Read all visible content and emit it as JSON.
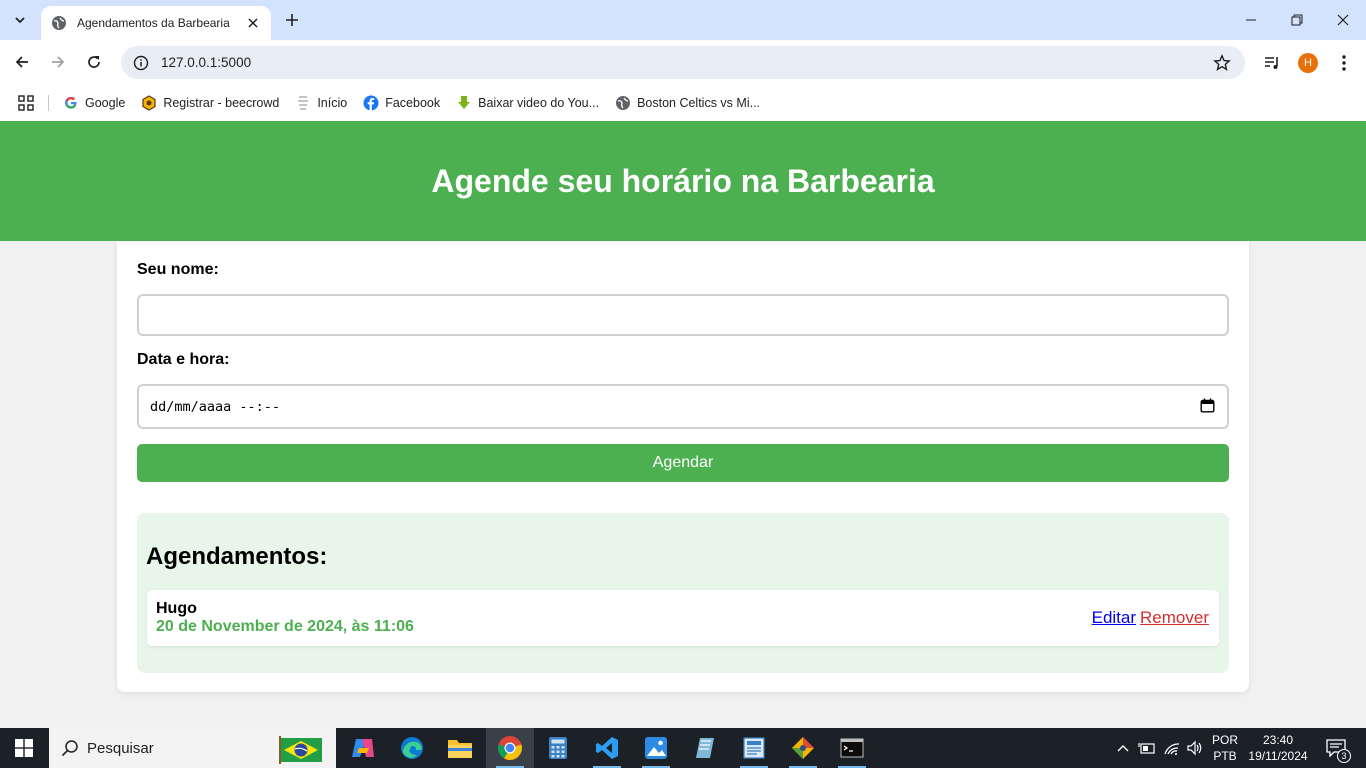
{
  "browser": {
    "tab_title": "Agendamentos da Barbearia",
    "url": "127.0.0.1:5000",
    "profile_initial": "H",
    "bookmarks": [
      {
        "label": "Google",
        "icon": "google-icon"
      },
      {
        "label": "Registrar - beecrowd",
        "icon": "beecrowd-icon"
      },
      {
        "label": "Início",
        "icon": "page-icon"
      },
      {
        "label": "Facebook",
        "icon": "facebook-icon"
      },
      {
        "label": "Baixar video do You...",
        "icon": "download-icon"
      },
      {
        "label": "Boston Celtics vs Mi...",
        "icon": "globe-icon"
      }
    ]
  },
  "page": {
    "title": "Agende seu horário na Barbearia",
    "form": {
      "name_label": "Seu nome:",
      "name_value": "",
      "datetime_label": "Data e hora:",
      "datetime_placeholder": "dd/mm/aaaa --:--",
      "submit_label": "Agendar"
    },
    "appointments": {
      "heading": "Agendamentos:",
      "items": [
        {
          "name": "Hugo",
          "datetime": "20 de November de 2024, às 11:06",
          "edit_label": "Editar",
          "remove_label": "Remover"
        }
      ]
    }
  },
  "taskbar": {
    "search_placeholder": "Pesquisar",
    "language_line1": "POR",
    "language_line2": "PTB",
    "time": "23:40",
    "date": "19/11/2024",
    "notification_count": "3"
  },
  "colors": {
    "brand_green": "#4caf50",
    "panel_green": "#e8f5e9",
    "remove_red": "#d32f2f",
    "edit_blue": "#0000ee"
  }
}
